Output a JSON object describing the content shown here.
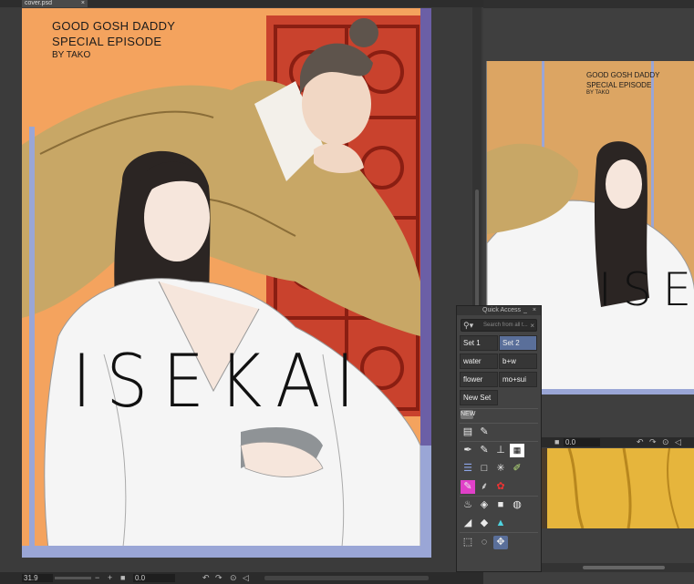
{
  "document_tab": {
    "label": "cover.psd",
    "close": "×"
  },
  "cover": {
    "title_line1": "GOOD GOSH DADDY",
    "title_line2": "SPECIAL EPISODE",
    "author": "BY TAKO",
    "big_title": "ISEKAI"
  },
  "navigator": {
    "title_line1": "GOOD GOSH DADDY",
    "title_line2": "SPECIAL EPISODE",
    "author": "BY TAKO",
    "big_title": "ISE"
  },
  "status_bar": {
    "zoom": "31.9",
    "zoom_out": "−",
    "zoom_in": "+",
    "rotation": "0.0"
  },
  "sub_view": {
    "rotation": "0.0"
  },
  "quick_access": {
    "title": "Quick Access",
    "minimize": "_",
    "close": "×",
    "search_placeholder": "Search from all t...",
    "sets": [
      {
        "label": "Set 1",
        "active": false
      },
      {
        "label": "Set 2",
        "active": true
      },
      {
        "label": "water",
        "active": false
      },
      {
        "label": "b+w",
        "active": false
      },
      {
        "label": "flower",
        "active": false
      },
      {
        "label": "mo+sui",
        "active": false
      },
      {
        "label": "New Set",
        "active": false
      }
    ],
    "tools": [
      "new-badge-icon",
      "canvas-tool-icon",
      "pen-icon",
      "pen-icon",
      "pen-icon",
      "ink-icon",
      "pattern-icon",
      "lines-icon",
      "rectangle-icon",
      "sparkle-icon",
      "pencil-icon",
      "magenta-brush-icon",
      "brush-icon",
      "stamp-icon",
      "drop-icon",
      "fill-icon",
      "square-fill-icon",
      "bucket-icon",
      "eraser-icon",
      "eraser-icon",
      "tone-icon",
      "selection-icon",
      "lasso-icon",
      "move-icon"
    ]
  },
  "colors": {
    "accent": "#5a6f9a",
    "cover_bg": "#f4a35e",
    "robe_mustard": "#c8a766",
    "window_red": "#c9422d"
  }
}
